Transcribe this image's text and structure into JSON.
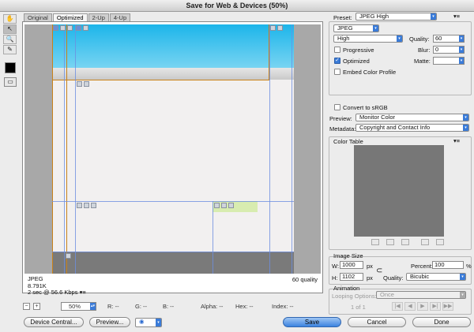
{
  "title": "Save for Web & Devices (50%)",
  "tabs": [
    "Original",
    "Optimized",
    "2-Up",
    "4-Up"
  ],
  "active_tab": 1,
  "tools": [
    "hand-icon",
    "slice-select-icon",
    "zoom-icon",
    "eyedropper-icon"
  ],
  "tool_glyphs": [
    "✋",
    "↖",
    "🔍",
    "✎"
  ],
  "preview": {
    "format": "JPEG",
    "size": "8.791K",
    "time": "2 sec @ 56.6 Kbps",
    "quality": "60 quality"
  },
  "status": {
    "zoom": "50%",
    "r": "R: --",
    "g": "G: --",
    "b": "B: --",
    "alpha": "Alpha: --",
    "hex": "Hex: --",
    "index": "Index: --"
  },
  "buttons": {
    "device_central": "Device Central...",
    "preview": "Preview...",
    "save": "Save",
    "cancel": "Cancel",
    "done": "Done"
  },
  "settings": {
    "preset_label": "Preset:",
    "preset": "JPEG High",
    "format": "JPEG",
    "quality_level": "High",
    "quality_label": "Quality:",
    "quality": "60",
    "blur_label": "Blur:",
    "blur": "0",
    "matte_label": "Matte:",
    "progressive": "Progressive",
    "progressive_checked": false,
    "optimized": "Optimized",
    "optimized_checked": true,
    "embed": "Embed Color Profile",
    "embed_checked": false,
    "convert": "Convert to sRGB",
    "convert_checked": false,
    "preview_label": "Preview:",
    "preview": "Monitor Color",
    "metadata_label": "Metadata:",
    "metadata": "Copyright and Contact Info"
  },
  "color_table": {
    "title": "Color Table"
  },
  "image_size": {
    "title": "Image Size",
    "w_label": "W:",
    "w": "1000",
    "h_label": "H:",
    "h": "1102",
    "unit": "px",
    "percent_label": "Percent:",
    "percent": "100",
    "pct": "%",
    "quality_label": "Quality:",
    "quality": "Bicubic"
  },
  "animation": {
    "title": "Animation",
    "looping_label": "Looping Options:",
    "looping": "Once",
    "frame": "1 of 1"
  },
  "colors": {
    "accent": "#3a7bd8",
    "sky": "#1cb5ea",
    "footer": "#7a7a7a"
  }
}
